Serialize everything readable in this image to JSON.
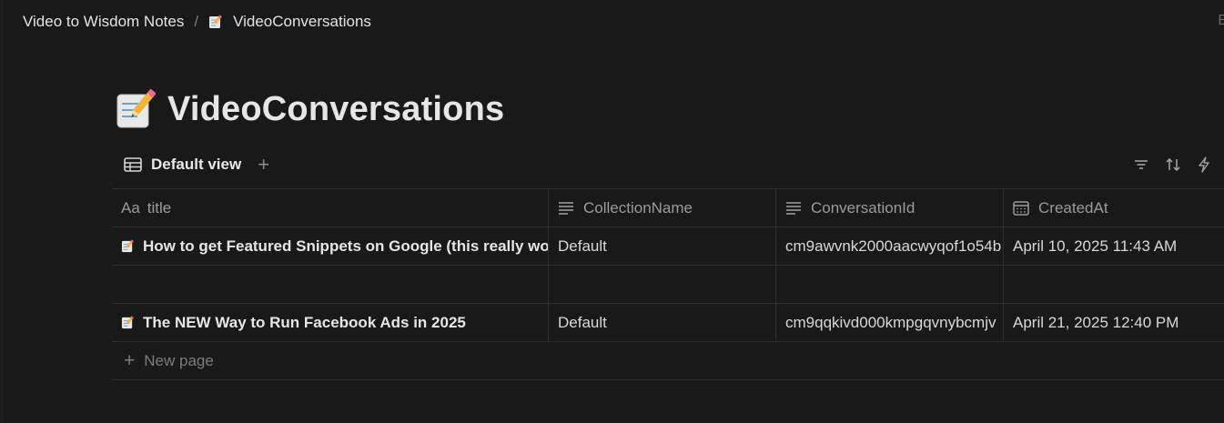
{
  "breadcrumb": {
    "parent": "Video to Wisdom Notes",
    "separator": "/",
    "current": "VideoConversations",
    "right_clip": "E"
  },
  "page": {
    "icon": "memo-emoji",
    "title": "VideoConversations"
  },
  "view": {
    "tab_label": "Default view",
    "add_label": "+",
    "toolbar_icons": [
      "filter-icon",
      "sort-icon",
      "automation-icon"
    ]
  },
  "table": {
    "columns": [
      {
        "label": "title",
        "icon": "Aa"
      },
      {
        "label": "CollectionName",
        "icon": "text-lines-icon"
      },
      {
        "label": "ConversationId",
        "icon": "text-lines-icon"
      },
      {
        "label": "CreatedAt",
        "icon": "calendar-icon"
      }
    ],
    "rows": [
      {
        "title": "How to get Featured Snippets on Google (this really works)",
        "collection": "Default",
        "conversation_id": "cm9awvnk2000aacwyqof1o54b",
        "created": "April 10, 2025 11:43 AM"
      },
      {
        "title": "",
        "collection": "",
        "conversation_id": "",
        "created": ""
      },
      {
        "title": "The NEW Way to Run Facebook Ads in 2025",
        "collection": "Default",
        "conversation_id": "cm9qqkivd000kmpgqvnybcmjv",
        "created": "April 21, 2025 12:40 PM"
      }
    ],
    "new_page_label": "New page"
  },
  "colors": {
    "background": "#191919",
    "border": "#2f2f2f",
    "text": "#d4d4d4",
    "muted": "#9b9b9b"
  }
}
